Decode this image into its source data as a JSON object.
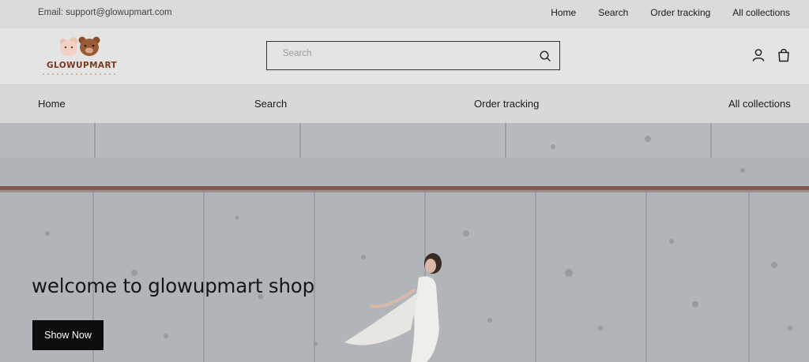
{
  "topbar": {
    "email": "Email: support@glowupmart.com",
    "links": [
      "Home",
      "Search",
      "Order tracking",
      "All collections"
    ]
  },
  "header": {
    "logo_text": "GLOWUPMART",
    "search_placeholder": "Search",
    "icons": [
      "search-icon",
      "account-icon",
      "cart-bag-icon"
    ]
  },
  "nav": {
    "items": [
      "Home",
      "Search",
      "Order tracking",
      "All collections"
    ]
  },
  "hero": {
    "heading": "welcome to glowupmart shop",
    "button_label": "Show Now"
  },
  "colors": {
    "topbar_bg": "#dbdbdb",
    "header_bg": "#e4e4e4",
    "nav_bg": "#d8d8d8",
    "button_bg": "#0d0d0d",
    "logo_brown": "#7a3b1e"
  }
}
